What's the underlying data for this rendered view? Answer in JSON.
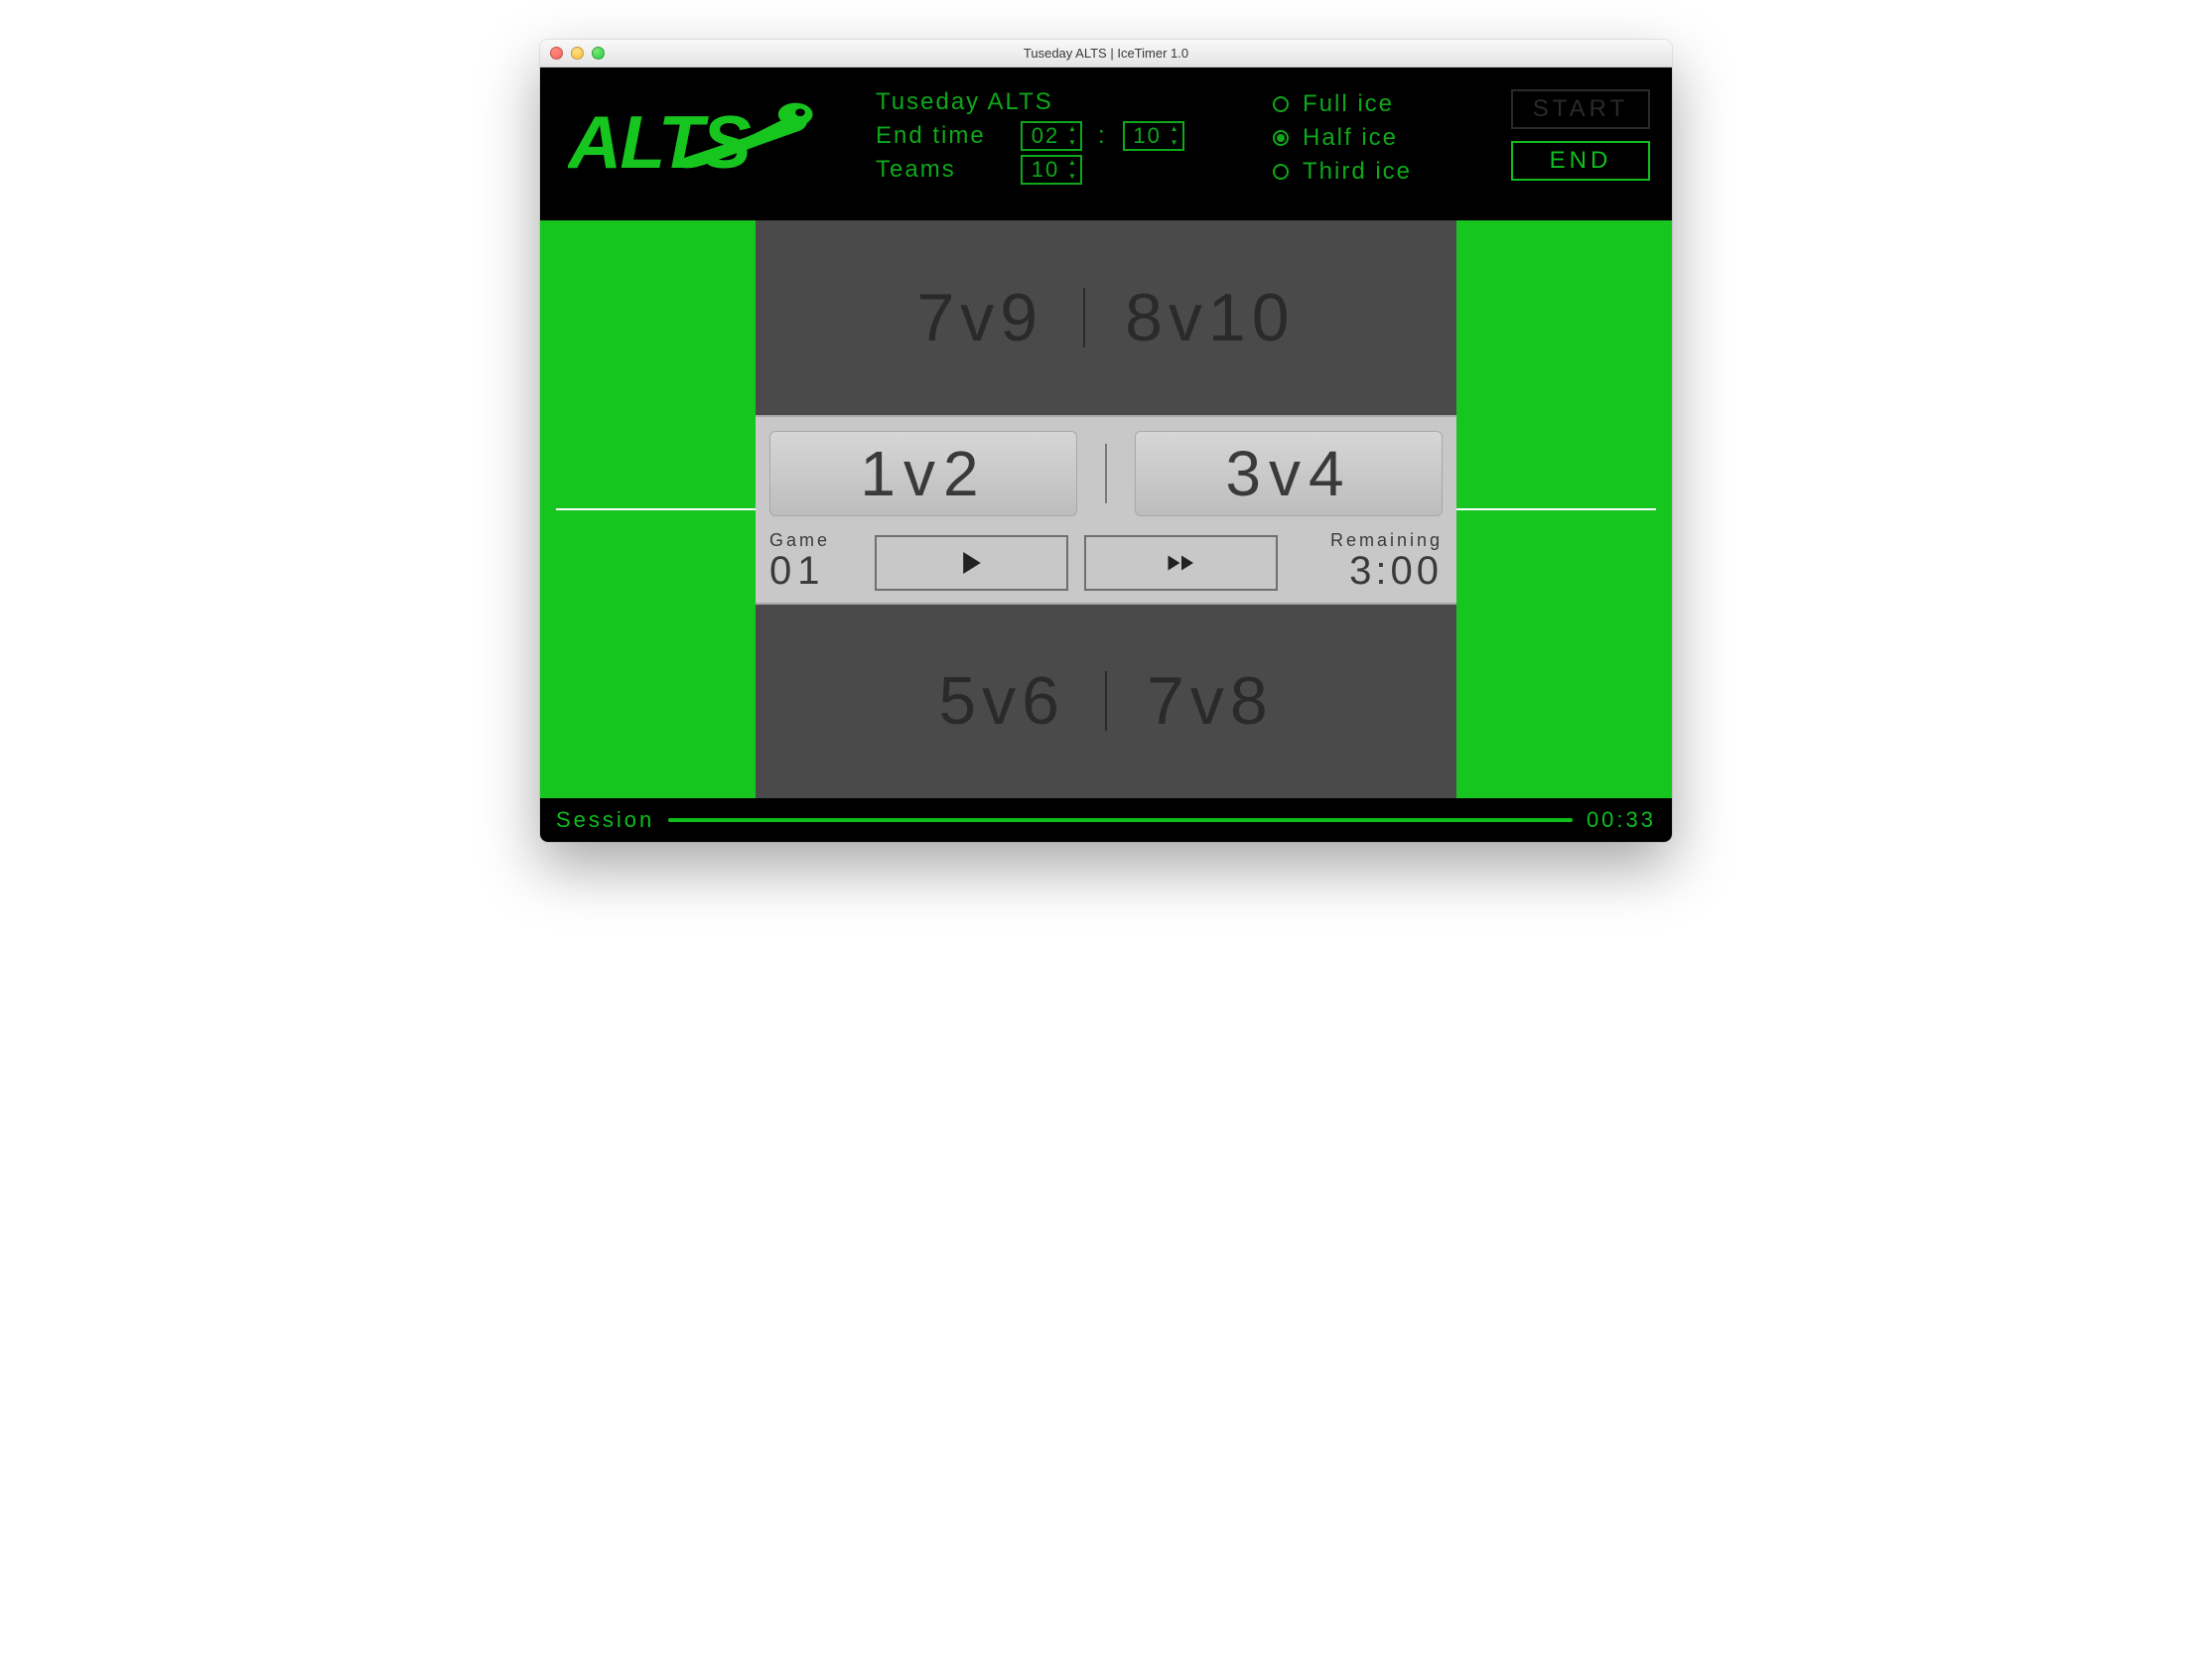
{
  "window": {
    "title": "Tuseday ALTS | IceTimer 1.0"
  },
  "header": {
    "logo_text": "ALTS",
    "session_name": "Tuseday ALTS",
    "end_time_label": "End time",
    "end_time_hour": "02",
    "end_time_min": "10",
    "teams_label": "Teams",
    "teams_value": "10",
    "ice_options": [
      {
        "label": "Full ice",
        "selected": false
      },
      {
        "label": "Half ice",
        "selected": true
      },
      {
        "label": "Third ice",
        "selected": false
      }
    ],
    "start_label": "START",
    "end_label": "END"
  },
  "schedule": {
    "prev": [
      "7v9",
      "8v10"
    ],
    "current": [
      "1v2",
      "3v4"
    ],
    "next": [
      "5v6",
      "7v8"
    ]
  },
  "game": {
    "game_label": "Game",
    "game_number": "01",
    "remaining_label": "Remaining",
    "remaining_value": "3:00"
  },
  "footer": {
    "session_label": "Session",
    "elapsed": "00:33"
  },
  "colors": {
    "green": "#17c51f",
    "accent": "#0fbf1d"
  }
}
